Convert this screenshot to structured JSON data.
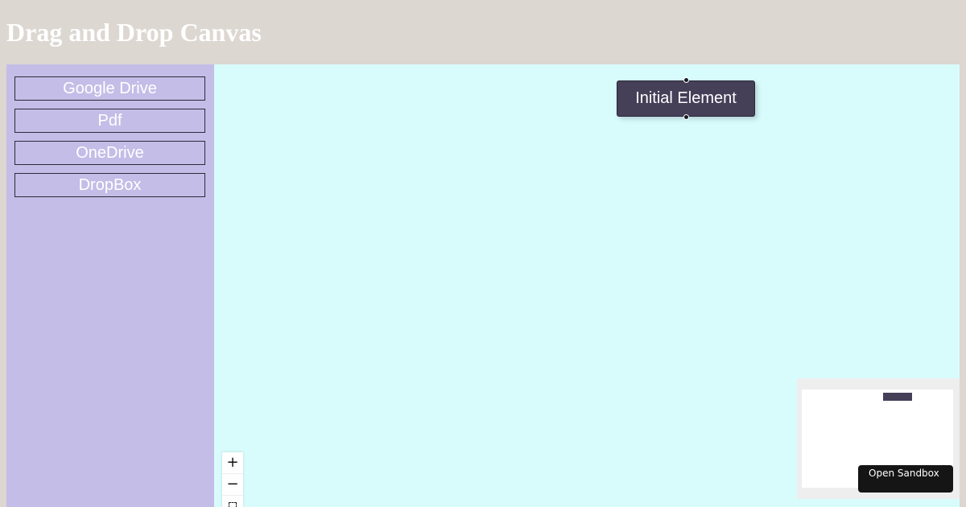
{
  "page": {
    "title": "Drag and Drop Canvas"
  },
  "sidebar": {
    "items": [
      {
        "label": "Google Drive"
      },
      {
        "label": "Pdf"
      },
      {
        "label": "OneDrive"
      },
      {
        "label": "DropBox"
      }
    ]
  },
  "canvas": {
    "nodes": [
      {
        "label": "Initial Element"
      }
    ],
    "controls": {
      "zoom_in_icon": "plus-icon",
      "zoom_out_icon": "minus-icon",
      "fit_view_icon": "fit-view-icon"
    }
  },
  "sandbox": {
    "label": "Open Sandbox"
  },
  "colors": {
    "header_bg": "#dcd7d1",
    "sidebar_bg": "#c4bde7",
    "canvas_bg": "#d8fcfc",
    "node_bg": "#463f58"
  }
}
